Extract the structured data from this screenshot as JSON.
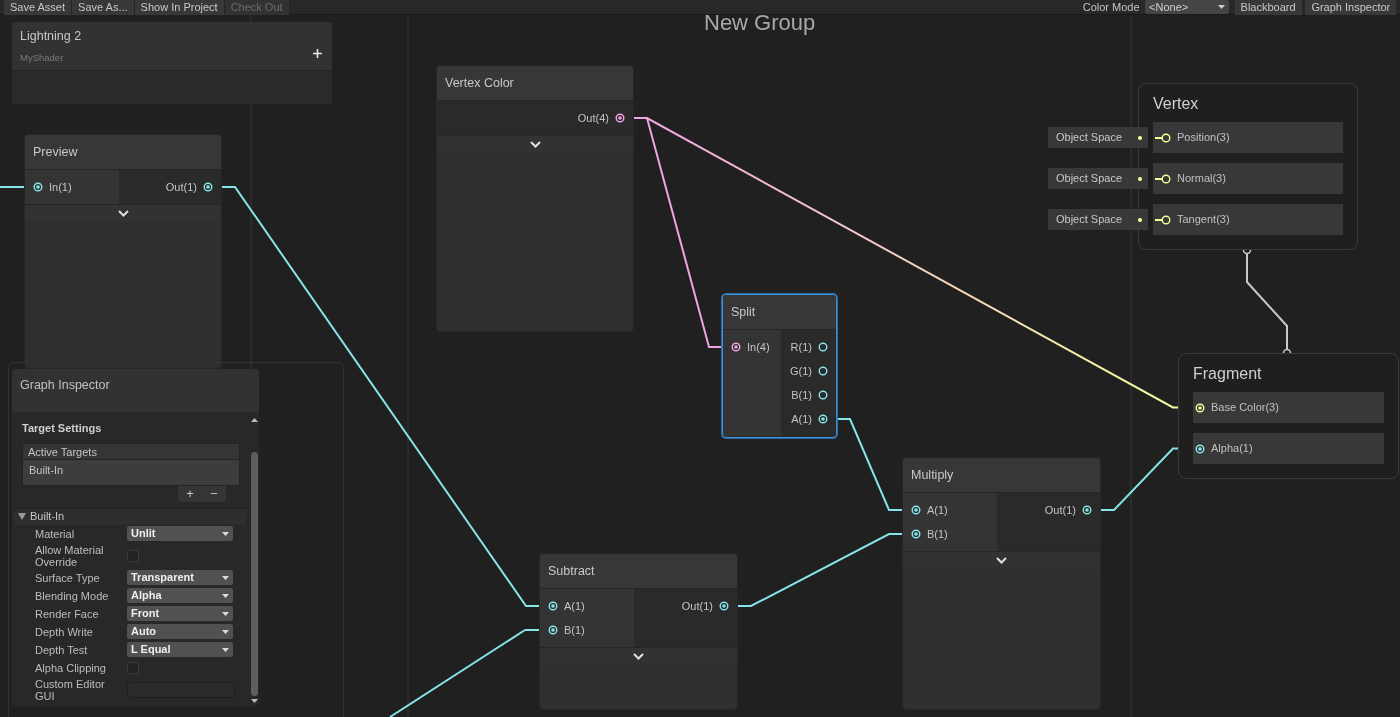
{
  "toolbar": {
    "buttons": [
      {
        "label": "Save Asset",
        "disabled": false
      },
      {
        "label": "Save As...",
        "disabled": false
      },
      {
        "label": "Show In Project",
        "disabled": false
      },
      {
        "label": "Check Out",
        "disabled": true
      }
    ],
    "color_mode": {
      "label": "Color Mode",
      "value": "<None>"
    },
    "panel_buttons": [
      {
        "label": "Blackboard"
      },
      {
        "label": "Graph Inspector"
      }
    ]
  },
  "group": {
    "title": "New Group"
  },
  "blackboard": {
    "title": "Lightning 2",
    "subtitle": "MyShader"
  },
  "nodes": [
    {
      "title": "Preview",
      "selected": false,
      "preview_expander": true,
      "inputs": [
        {
          "label": "In(1)",
          "kind": "float",
          "connected": true
        }
      ],
      "outputs": [
        {
          "label": "Out(1)",
          "kind": "float",
          "connected": true
        }
      ]
    },
    {
      "title": "Vertex Color",
      "selected": false,
      "preview_expander": true,
      "outputs": [
        {
          "label": "Out(4)",
          "kind": "vector4",
          "connected": true
        }
      ]
    },
    {
      "title": "Split",
      "selected": true,
      "preview_expander": false,
      "inputs": [
        {
          "label": "In(4)",
          "kind": "vector4",
          "connected": true
        }
      ],
      "outputs": [
        {
          "label": "R(1)",
          "kind": "float",
          "connected": false
        },
        {
          "label": "G(1)",
          "kind": "float",
          "connected": false
        },
        {
          "label": "B(1)",
          "kind": "float",
          "connected": false
        },
        {
          "label": "A(1)",
          "kind": "float",
          "connected": true
        }
      ]
    },
    {
      "title": "Multiply",
      "selected": false,
      "preview_expander": true,
      "inputs": [
        {
          "label": "A(1)",
          "kind": "float",
          "connected": true
        },
        {
          "label": "B(1)",
          "kind": "float",
          "connected": true
        }
      ],
      "outputs": [
        {
          "label": "Out(1)",
          "kind": "float",
          "connected": true
        }
      ]
    },
    {
      "title": "Subtract",
      "selected": false,
      "preview_expander": true,
      "inputs": [
        {
          "label": "A(1)",
          "kind": "float",
          "connected": true
        },
        {
          "label": "B(1)",
          "kind": "float",
          "connected": true
        }
      ],
      "outputs": [
        {
          "label": "Out(1)",
          "kind": "float",
          "connected": true
        }
      ]
    }
  ],
  "contexts": [
    {
      "title": "Vertex",
      "blocks": [
        {
          "label": "Position(3)",
          "kind": "vector3",
          "connected": false,
          "default_value": "Object Space"
        },
        {
          "label": "Normal(3)",
          "kind": "vector3",
          "connected": false,
          "default_value": "Object Space"
        },
        {
          "label": "Tangent(3)",
          "kind": "vector3",
          "connected": false,
          "default_value": "Object Space"
        }
      ]
    },
    {
      "title": "Fragment",
      "blocks": [
        {
          "label": "Base Color(3)",
          "kind": "vector3",
          "connected": true
        },
        {
          "label": "Alpha(1)",
          "kind": "float",
          "connected": true
        }
      ]
    }
  ],
  "graph_inspector": {
    "title": "Graph Inspector",
    "section_title": "Target Settings",
    "targets_list": {
      "header": "Active Targets",
      "items": [
        "Built-In"
      ],
      "add": "+",
      "remove": "−"
    },
    "target": {
      "title": "Built-In",
      "expanded": true,
      "fields": [
        {
          "label": "Material",
          "kind": "dropdown",
          "value": "Unlit"
        },
        {
          "label": "Allow Material Override",
          "kind": "checkbox",
          "checked": false
        },
        {
          "label": "Surface Type",
          "kind": "dropdown",
          "value": "Transparent"
        },
        {
          "label": "Blending Mode",
          "kind": "dropdown",
          "value": "Alpha"
        },
        {
          "label": "Render Face",
          "kind": "dropdown",
          "value": "Front"
        },
        {
          "label": "Depth Write",
          "kind": "dropdown",
          "value": "Auto"
        },
        {
          "label": "Depth Test",
          "kind": "dropdown",
          "value": "L Equal"
        },
        {
          "label": "Alpha Clipping",
          "kind": "checkbox",
          "checked": false
        },
        {
          "label": "Custom Editor GUI",
          "kind": "text"
        }
      ]
    }
  }
}
